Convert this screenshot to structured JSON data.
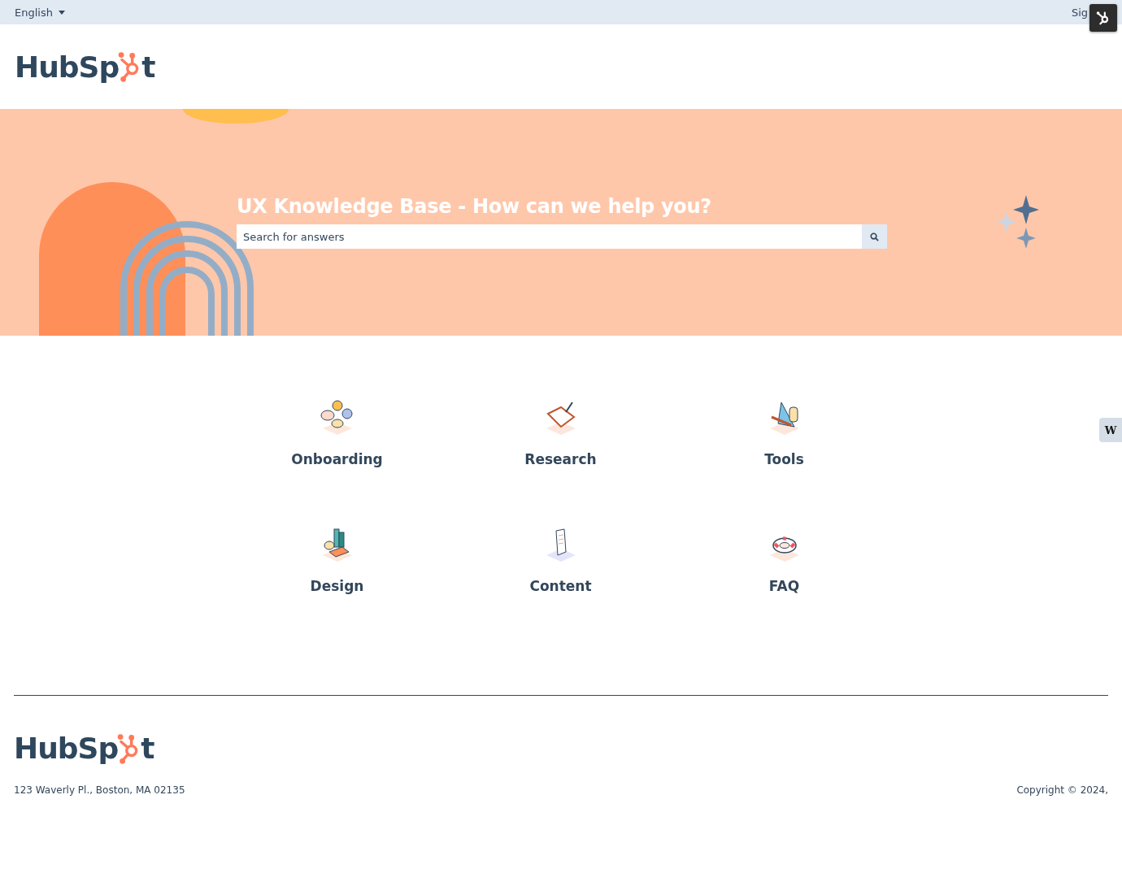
{
  "top_bar": {
    "language": "English",
    "sign_in": "Sig"
  },
  "header": {
    "logo": {
      "start": "HubSp",
      "end": "t"
    }
  },
  "hero": {
    "title": "UX Knowledge Base - How can we help you?",
    "search": {
      "placeholder": "Search for answers"
    }
  },
  "categories": [
    {
      "label": "Onboarding"
    },
    {
      "label": "Research"
    },
    {
      "label": "Tools"
    },
    {
      "label": "Design"
    },
    {
      "label": "Content"
    },
    {
      "label": "FAQ"
    }
  ],
  "side_tab": {
    "label": "W"
  },
  "footer": {
    "logo": {
      "start": "HubSp",
      "end": "t"
    },
    "address": "123 Waverly Pl., Boston, MA 02135",
    "copyright": "Copyright © 2024,"
  }
}
